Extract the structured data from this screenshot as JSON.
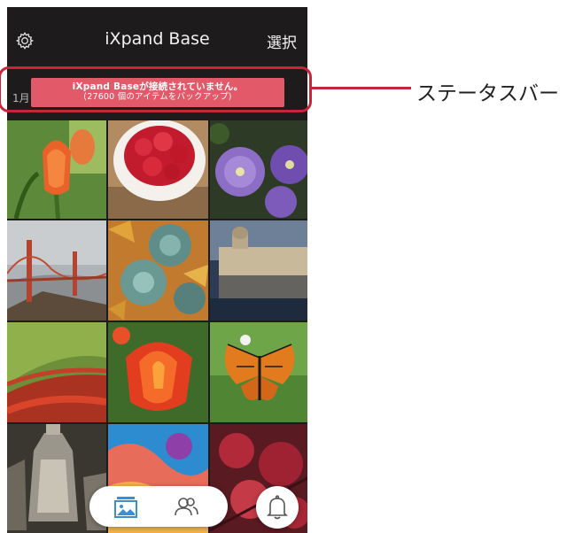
{
  "header": {
    "title": "iXpand Base",
    "select_label": "選択",
    "settings_icon": "gear-icon"
  },
  "status": {
    "month_label": "1月",
    "banner_line1": "iXpand Baseが接続されていません。",
    "banner_line2": "(27600 個のアイテムをバックアップ)",
    "banner_color": "#e25a6a"
  },
  "gallery": {
    "photos": [
      "orange-tulips",
      "raspberries-in-bowl",
      "purple-petunias",
      "golden-gate-bridge-in-fog",
      "succulents-and-autumn-leaves",
      "palace-reflection-in-water",
      "tulip-field",
      "red-tulip-closeup",
      "monarch-butterfly",
      "crystal-glassware",
      "coral-reef",
      "red-foliage"
    ]
  },
  "tabbar": {
    "photos_icon": "photos-icon",
    "people_icon": "people-icon",
    "notifications_icon": "bell-icon"
  },
  "annotation": {
    "label": "ステータスバー",
    "color": "#c8243a"
  }
}
